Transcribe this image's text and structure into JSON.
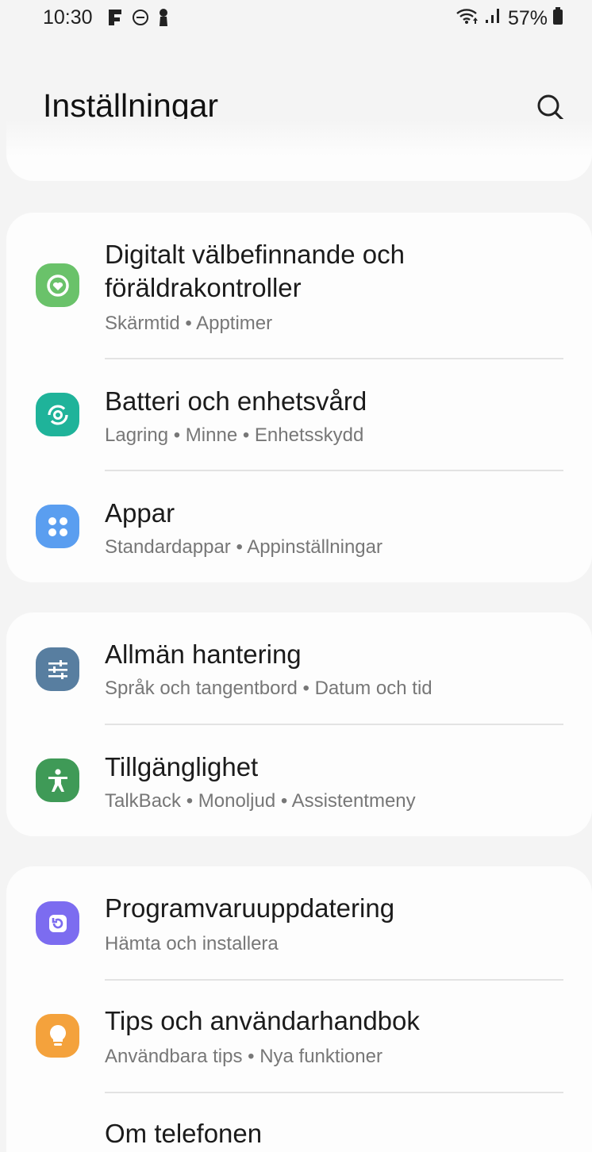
{
  "status_bar": {
    "time": "10:30",
    "battery": "57%"
  },
  "header": {
    "title": "Inställningar"
  },
  "items": [
    {
      "title_line1": "Digitalt välbefinnande och",
      "title_line2": "föräldrakontroller",
      "subtitle": "Skärmtid • Apptimer",
      "icon": "wellbeing-icon",
      "icon_color": "#6ac26a"
    },
    {
      "title": "Batteri och enhetsvård",
      "subtitle": "Lagring • Minne • Enhetsskydd",
      "icon": "device-care-icon",
      "icon_color": "#1fb39a"
    },
    {
      "title": "Appar",
      "subtitle": "Standardappar • Appinställningar",
      "icon": "apps-icon",
      "icon_color": "#5a9ef0"
    },
    {
      "title": "Allmän hantering",
      "subtitle": "Språk och tangentbord • Datum och tid",
      "icon": "general-management-icon",
      "icon_color": "#587ea0"
    },
    {
      "title": "Tillgänglighet",
      "subtitle": "TalkBack • Monoljud • Assistentmeny",
      "icon": "accessibility-icon",
      "icon_color": "#3f9a57"
    },
    {
      "title": "Programvaruuppdatering",
      "subtitle": "Hämta och installera",
      "icon": "software-update-icon",
      "icon_color": "#7c6cf0"
    },
    {
      "title": "Tips och användarhandbok",
      "subtitle": "Användbara tips • Nya funktioner",
      "icon": "tips-icon",
      "icon_color": "#f4a23c"
    },
    {
      "title": "Om telefonen"
    }
  ]
}
